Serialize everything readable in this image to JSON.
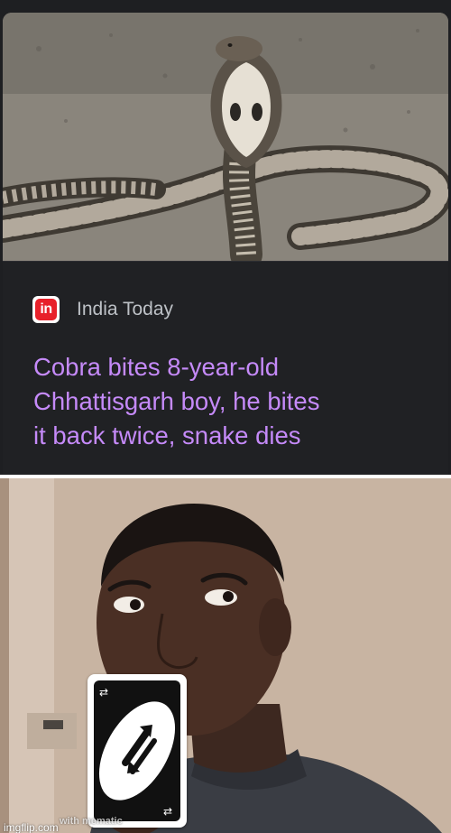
{
  "news_card": {
    "source": {
      "logo_text": "in",
      "name": "India Today"
    },
    "headline_lines": [
      "Cobra bites 8-year-old",
      "Chhattisgarh boy, he bites",
      "it back twice, snake dies"
    ],
    "photo_icon": "cobra-photo",
    "colors": {
      "card_background": "#202124",
      "source_text": "#bdc1c6",
      "headline_text": "#c58af9",
      "logo_red": "#e8202a"
    }
  },
  "reaction_image": {
    "photo_icon": "man-holding-uno-reverse-card-photo",
    "card_icon": "uno-reverse-card-icon",
    "watermarks": {
      "mematic": "with mematic",
      "imgflip": "imgflip.com"
    }
  }
}
